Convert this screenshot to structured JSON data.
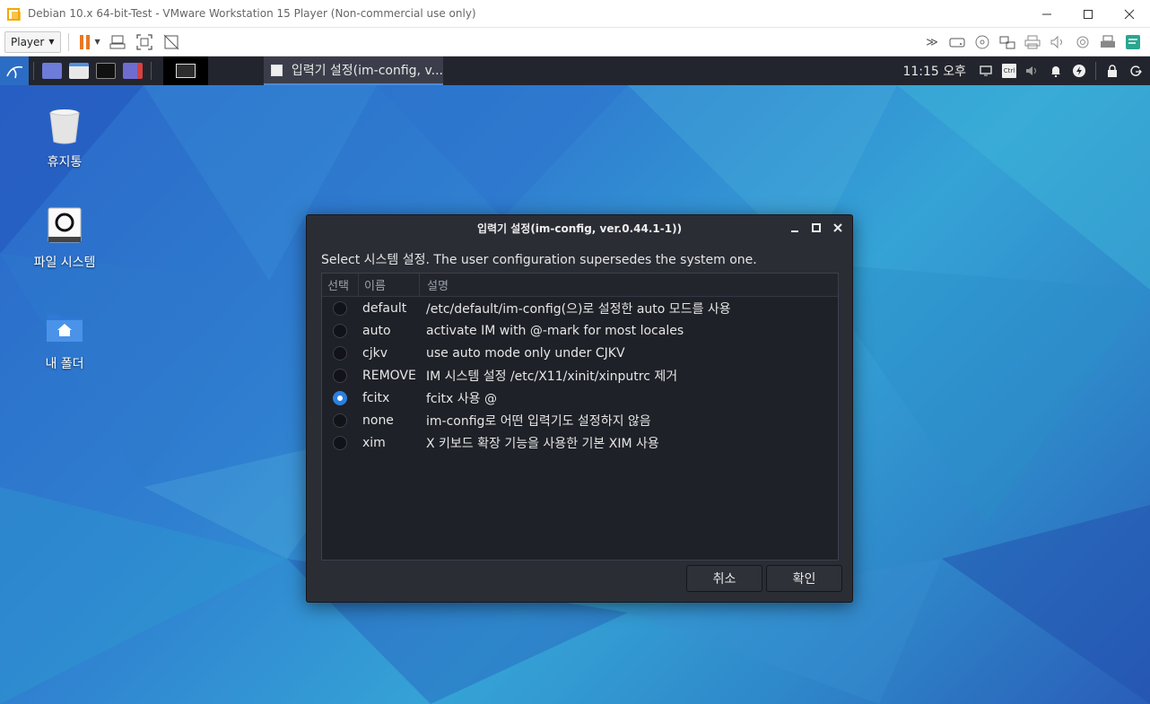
{
  "window": {
    "title": "Debian 10.x 64-bit-Test - VMware Workstation 15 Player (Non-commercial use only)",
    "controls": [
      "minimize-icon",
      "maximize-icon",
      "close-icon"
    ]
  },
  "toolbar": {
    "player_label": "Player",
    "left_icons": [
      "pause-icon",
      "send-ctrl-alt-del-icon",
      "fullscreen-icon",
      "unity-icon"
    ],
    "right_icons": [
      "chevron-more-icon",
      "hard-disk-icon",
      "cd-dvd-icon",
      "network-adapter-icon",
      "printer-icon",
      "sound-card-icon",
      "camera-icon",
      "usb-printer-icon",
      "message-log-icon"
    ]
  },
  "panel": {
    "task_title": "입력기 설정(im-config, v...",
    "clock": "11:15 오후"
  },
  "desktop_icons": [
    {
      "label": "휴지통",
      "icon": "trash-icon"
    },
    {
      "label": "파일 시스템",
      "icon": "drive-icon"
    },
    {
      "label": "내 폴더",
      "icon": "home-folder-icon"
    }
  ],
  "dialog": {
    "title": "입력기 설정(im-config, ver.0.44.1-1))",
    "prompt": "Select 시스템 설정. The user configuration supersedes the system one.",
    "columns": [
      "선택",
      "이름",
      "설명"
    ],
    "rows": [
      {
        "name": "default",
        "desc": "/etc/default/im-config(으)로 설정한 auto 모드를 사용",
        "selected": false
      },
      {
        "name": "auto",
        "desc": "activate IM with @-mark for most locales",
        "selected": false
      },
      {
        "name": "cjkv",
        "desc": "use auto mode only under CJKV",
        "selected": false
      },
      {
        "name": "REMOVE",
        "desc": "IM 시스템 설정 /etc/X11/xinit/xinputrc 제거",
        "selected": false
      },
      {
        "name": "fcitx",
        "desc": "fcitx 사용 @",
        "selected": true
      },
      {
        "name": "none",
        "desc": "im-config로 어떤 입력기도 설정하지 않음",
        "selected": false
      },
      {
        "name": "xim",
        "desc": "X 키보드 확장 기능을 사용한 기본 XIM 사용",
        "selected": false
      }
    ],
    "cancel_label": "취소",
    "ok_label": "확인"
  }
}
